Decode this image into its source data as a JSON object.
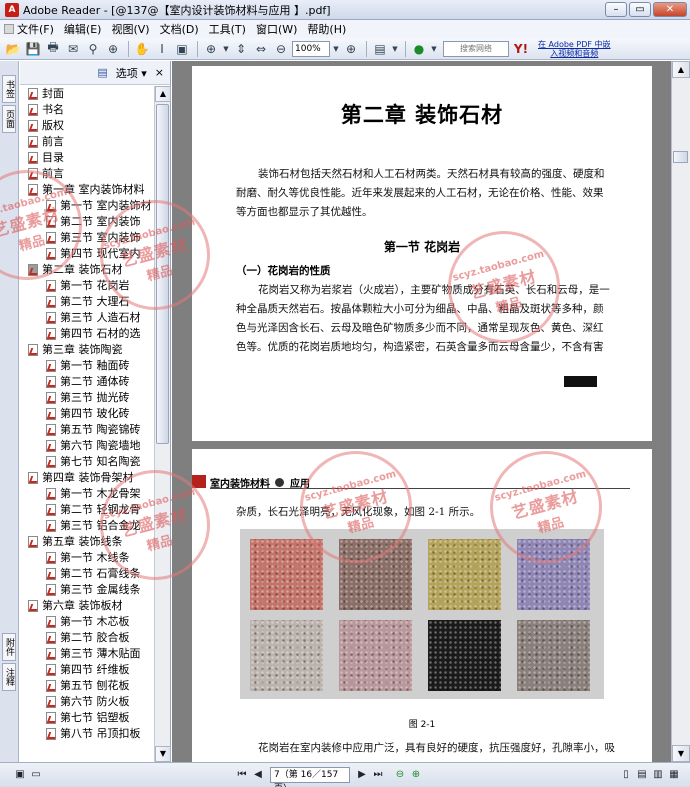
{
  "window": {
    "title": "Adobe Reader - [@137@【室内设计装饰材料与应用 】.pdf]",
    "app_icon": "adobe-reader-icon"
  },
  "menu": [
    "文件(F)",
    "编辑(E)",
    "视图(V)",
    "文档(D)",
    "工具(T)",
    "窗口(W)",
    "帮助(H)"
  ],
  "toolbar": {
    "zoom": "100%",
    "search_placeholder": "搜索网络",
    "adobe_link_line1": "在 Adobe PDF 中嵌",
    "adobe_link_line2": "入视频和音频"
  },
  "side_tabs": [
    "书签",
    "页面",
    "附件",
    "注释"
  ],
  "panel": {
    "options_label": "选项",
    "close": "×"
  },
  "bookmarks": [
    {
      "label": "封面",
      "level": 0,
      "grey": false
    },
    {
      "label": "书名",
      "level": 0,
      "grey": false
    },
    {
      "label": "版权",
      "level": 0,
      "grey": false
    },
    {
      "label": "前言",
      "level": 0,
      "grey": false
    },
    {
      "label": "目录",
      "level": 0,
      "grey": false
    },
    {
      "label": "前言",
      "level": 0,
      "grey": false
    },
    {
      "label": "第一章 室内装饰材料",
      "level": 0,
      "grey": false
    },
    {
      "label": "第一节 室内装饰材",
      "level": 1,
      "grey": false
    },
    {
      "label": "第二节 室内装饰",
      "level": 1,
      "grey": false
    },
    {
      "label": "第三节 室内装饰",
      "level": 1,
      "grey": false
    },
    {
      "label": "第四节 现代室内",
      "level": 1,
      "grey": false
    },
    {
      "label": "第二章 装饰石材",
      "level": 0,
      "grey": true
    },
    {
      "label": "第一节 花岗岩",
      "level": 1,
      "grey": false
    },
    {
      "label": "第二节 大理石",
      "level": 1,
      "grey": false
    },
    {
      "label": "第三节 人造石材",
      "level": 1,
      "grey": false
    },
    {
      "label": "第四节 石材的选",
      "level": 1,
      "grey": false
    },
    {
      "label": "第三章 装饰陶瓷",
      "level": 0,
      "grey": false
    },
    {
      "label": "第一节 釉面砖",
      "level": 1,
      "grey": false
    },
    {
      "label": "第二节 通体砖",
      "level": 1,
      "grey": false
    },
    {
      "label": "第三节 抛光砖",
      "level": 1,
      "grey": false
    },
    {
      "label": "第四节 玻化砖",
      "level": 1,
      "grey": false
    },
    {
      "label": "第五节 陶瓷锦砖",
      "level": 1,
      "grey": false
    },
    {
      "label": "第六节 陶瓷墙地",
      "level": 1,
      "grey": false
    },
    {
      "label": "第七节 知名陶瓷",
      "level": 1,
      "grey": false
    },
    {
      "label": "第四章 装饰骨架材",
      "level": 0,
      "grey": false
    },
    {
      "label": "第一节 木龙骨架",
      "level": 1,
      "grey": false
    },
    {
      "label": "第二节 轻钢龙骨",
      "level": 1,
      "grey": false
    },
    {
      "label": "第三节 铝合金龙",
      "level": 1,
      "grey": false
    },
    {
      "label": "第五章 装饰线条",
      "level": 0,
      "grey": false
    },
    {
      "label": "第一节 木线条",
      "level": 1,
      "grey": false
    },
    {
      "label": "第二节 石膏线条",
      "level": 1,
      "grey": false
    },
    {
      "label": "第三节 金属线条",
      "level": 1,
      "grey": false
    },
    {
      "label": "第六章 装饰板材",
      "level": 0,
      "grey": false
    },
    {
      "label": "第一节 木芯板",
      "level": 1,
      "grey": false
    },
    {
      "label": "第二节 胶合板",
      "level": 1,
      "grey": false
    },
    {
      "label": "第三节 薄木贴面",
      "level": 1,
      "grey": false
    },
    {
      "label": "第四节 纤维板",
      "level": 1,
      "grey": false
    },
    {
      "label": "第五节 刨花板",
      "level": 1,
      "grey": false
    },
    {
      "label": "第六节 防火板",
      "level": 1,
      "grey": false
    },
    {
      "label": "第七节 铝塑板",
      "level": 1,
      "grey": false
    },
    {
      "label": "第八节 吊顶扣板",
      "level": 1,
      "grey": false
    }
  ],
  "page1": {
    "chapter_title": "第二章 装饰石材",
    "intro_lines": [
      "装饰石材包括天然石材和人工石材两类。天然石材具有较高的强度、硬度和",
      "耐磨、耐久等优良性能。近年来发展起来的人工石材，无论在价格、性能、效果",
      "等方面也都显示了其优越性。"
    ],
    "section_title": "第一节 花岗岩",
    "subsection": "（一）花岗岩的性质",
    "body_lines": [
      "花岗岩又称为岩浆岩（火成岩），主要矿物质成分有石英、长石和云母，是一",
      "种全晶质天然岩石。按晶体颗粒大小可分为细晶、中晶、粗晶及斑状等多种，颜",
      "色与光泽因含长石、云母及暗色矿物质多少而不同，通常呈现灰色、黄色、深红",
      "色等。优质的花岗岩质地均匀，构造紧密，石英含量多而云母含量少，不含有害"
    ]
  },
  "page2": {
    "running_head": "室内装饰材料",
    "running_head_suffix": "应用",
    "top_line": "杂质，长石光泽明亮，无风化现象，如图 2-1 所示。",
    "figure_caption": "图 2-1",
    "bottom_line": "花岗岩在室内装修中应用广泛，具有良好的硬度，抗压强度好，孔隙率小，吸",
    "tile_colors": [
      "#c4746a",
      "#8b6f66",
      "#b5a35a",
      "#8f86b6",
      "#bdb3ad",
      "#b9979a",
      "#1b1b1b",
      "#8a7f7a"
    ]
  },
  "watermark": {
    "line1": "scyz.taobao.com",
    "line2": "艺盛素材",
    "line3": "精品"
  },
  "status": {
    "page_text": "7（第 16／157 页）"
  }
}
